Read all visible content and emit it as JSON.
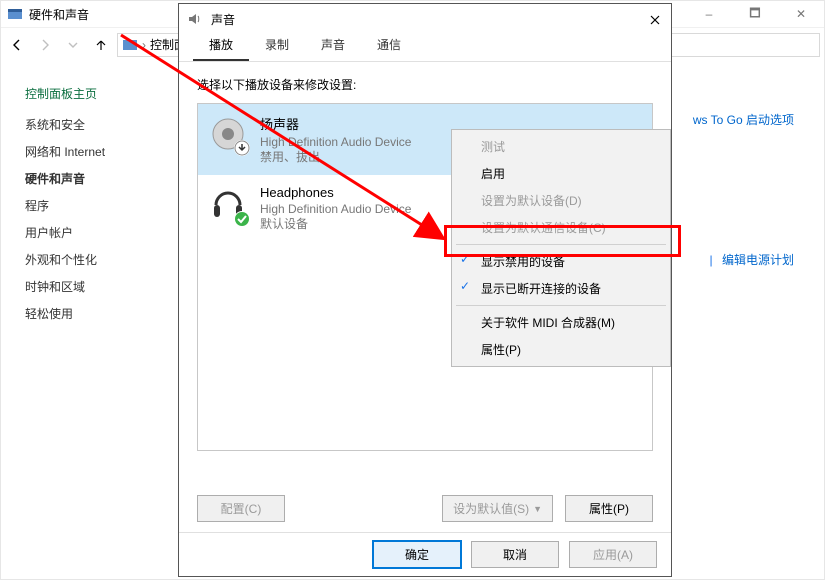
{
  "main_window": {
    "title": "硬件和声音",
    "breadcrumb": "控制面"
  },
  "win_controls": {
    "min": "–",
    "max": "🗖",
    "close": "✕"
  },
  "sidebar": {
    "heading": "控制面板主页",
    "items": [
      {
        "label": "系统和安全"
      },
      {
        "label": "网络和 Internet"
      },
      {
        "label": "硬件和声音",
        "bold": true
      },
      {
        "label": "程序"
      },
      {
        "label": "用户帐户"
      },
      {
        "label": "外观和个性化"
      },
      {
        "label": "时钟和区域"
      },
      {
        "label": "轻松使用"
      }
    ]
  },
  "content_links": {
    "right1": "ws To Go 启动选项",
    "right2": "编辑电源计划"
  },
  "dialog": {
    "title": "声音",
    "tabs": [
      "播放",
      "录制",
      "声音",
      "通信"
    ],
    "instruction": "选择以下播放设备来修改设置:",
    "devices": [
      {
        "name": "扬声器",
        "desc": "High Definition Audio Device",
        "status": "禁用、拔出",
        "badge": "down",
        "selected": true
      },
      {
        "name": "Headphones",
        "desc": "High Definition Audio Device",
        "status": "默认设备",
        "badge": "check",
        "selected": false
      }
    ],
    "btn_configure": "配置(C)",
    "btn_set_default": "设为默认值(S)",
    "btn_properties": "属性(P)",
    "btn_ok": "确定",
    "btn_cancel": "取消",
    "btn_apply": "应用(A)"
  },
  "context_menu": {
    "items": [
      {
        "label": "测试",
        "disabled": true
      },
      {
        "label": "启用"
      },
      {
        "label": "设置为默认设备(D)",
        "disabled": true
      },
      {
        "label": "设置为默认通信设备(C)",
        "disabled": true
      },
      {
        "sep": true
      },
      {
        "label": "显示禁用的设备",
        "checked": true
      },
      {
        "label": "显示已断开连接的设备",
        "checked": true
      },
      {
        "sep": true
      },
      {
        "label": "关于软件 MIDI 合成器(M)"
      },
      {
        "label": "属性(P)"
      }
    ]
  }
}
